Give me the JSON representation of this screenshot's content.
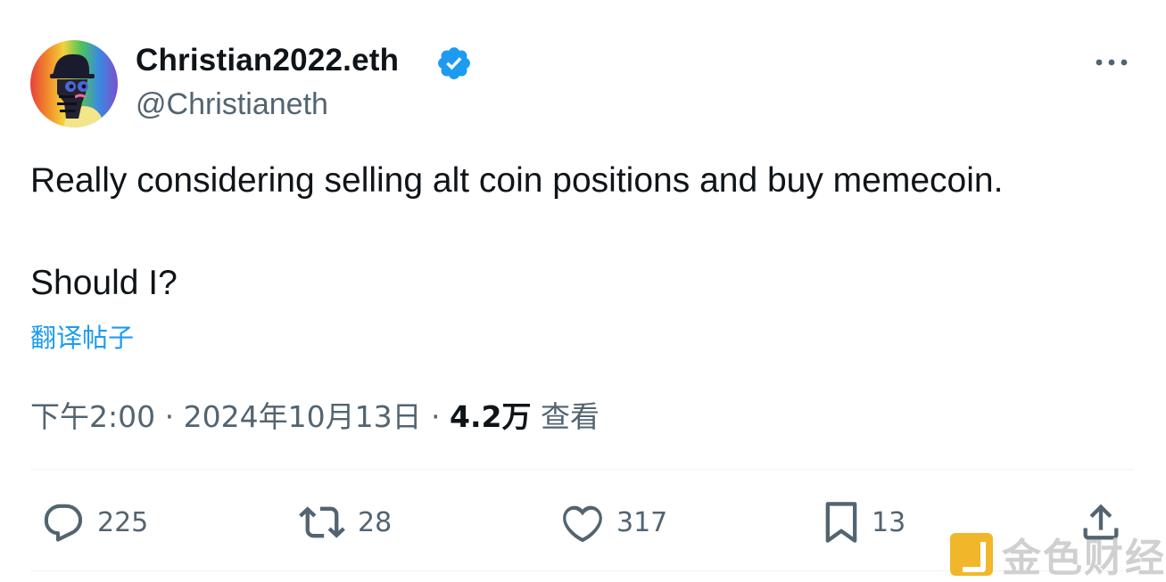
{
  "author": {
    "display_name": "Christian2022.eth",
    "handle": "@Christianeth",
    "verified": true,
    "verified_color": "#1d9bf0"
  },
  "menu_icon": "more-dots-icon",
  "tweet": {
    "line1": "Really considering selling alt coin positions and buy memecoin.",
    "line2": "Should I?",
    "translate_label": "翻译帖子"
  },
  "meta": {
    "time": "下午2:00",
    "separator": " · ",
    "date": "2024年10月13日",
    "views_count": "4.2万",
    "views_label": "查看"
  },
  "actions": {
    "reply": {
      "icon": "reply-icon",
      "count": "225"
    },
    "retweet": {
      "icon": "retweet-icon",
      "count": "28"
    },
    "like": {
      "icon": "heart-icon",
      "count": "317"
    },
    "bookmark": {
      "icon": "bookmark-icon",
      "count": "13"
    },
    "share": {
      "icon": "share-icon"
    }
  },
  "watermark": {
    "text": "金色财经",
    "logo": "jinse-logo"
  },
  "colors": {
    "text": "#0f1419",
    "secondary": "#536471",
    "link": "#1d9bf0",
    "divider": "#eff3f4"
  }
}
